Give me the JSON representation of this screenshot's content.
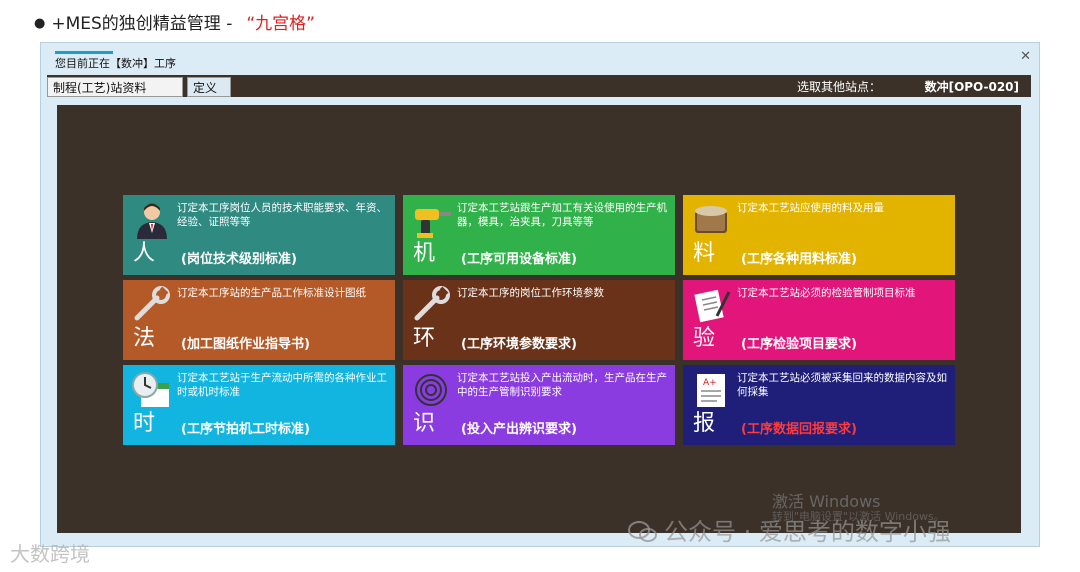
{
  "slide": {
    "bullet": "●",
    "title": "+MES的独创精益管理 -",
    "highlight": "“九宫格”"
  },
  "window": {
    "title": "您目前正在【数冲】工序",
    "close": "✕",
    "tabs": [
      "制程(工艺)站资料",
      "定义"
    ],
    "station_label": "选取其他站点：",
    "station_value": "数冲[OPO-020]"
  },
  "tiles": [
    {
      "char": "人",
      "desc": "订定本工序岗位人员的技术职能要求、年资、经验、证照等等",
      "std": "(岗位技术级别标准)",
      "color": "#2f8a82",
      "icon": "person-icon"
    },
    {
      "char": "机",
      "desc": "订定本工艺站跟生产加工有关设使用的生产机器，模具，治夹具，刀具等等",
      "std": "(工序可用设备标准)",
      "color": "#30b14a",
      "icon": "drill-icon"
    },
    {
      "char": "料",
      "desc": "订定本工艺站应使用的料及用量",
      "std": "(工序各种用料标准)",
      "color": "#e2b400",
      "icon": "material-roll-icon"
    },
    {
      "char": "法",
      "desc": "订定本工序站的生产品工作标准设计图纸",
      "std": "(加工图纸作业指导书)",
      "color": "#b45a28",
      "icon": "wrench-icon"
    },
    {
      "char": "环",
      "desc": "订定本工序的岗位工作环境参数",
      "std": "(工序环境参数要求)",
      "color": "#6a3218",
      "icon": "wrench-icon"
    },
    {
      "char": "验",
      "desc": "订定本工艺站必须的检验管制项目标准",
      "std": "(工序检验项目要求)",
      "color": "#e2167a",
      "icon": "checklist-icon"
    },
    {
      "char": "时",
      "desc": "订定本工艺站于生产流动中所需的各种作业工时或机时标准",
      "std": "(工序节拍机工时标准)",
      "color": "#12b4e0",
      "icon": "clock-calendar-icon"
    },
    {
      "char": "识",
      "desc": "订定本工艺站投入产出流动时，生产品在生产中的生产管制识别要求",
      "std": "(投入产出辨识要求)",
      "color": "#8a3ce0",
      "icon": "fingerprint-icon"
    },
    {
      "char": "报",
      "desc": "订定本工艺站必须被采集回来的数据内容及如何採集",
      "std": "(工序数据回报要求)",
      "color": "#1f1f7a",
      "icon": "report-card-icon",
      "std_color": "red"
    }
  ],
  "watermark": {
    "activate": "激活 Windows",
    "activate_sub": "转到\"电脑设置\"以激活 Windows。",
    "wechat": "公众号 · 爱思考的数字小强",
    "corner": "大数跨境"
  }
}
